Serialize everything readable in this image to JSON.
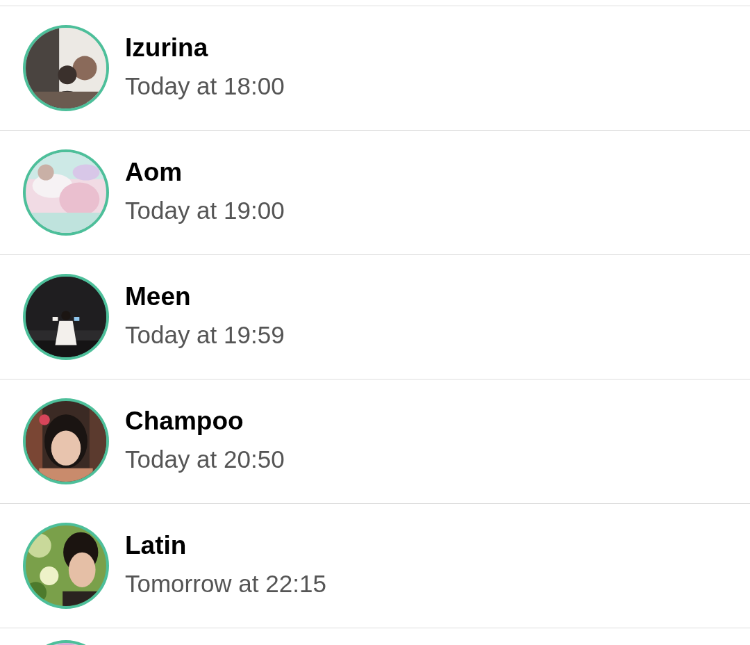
{
  "contacts": [
    {
      "avatar": {
        "kind": "picture"
      },
      "name": "Izurina",
      "time": "Today at 18:00"
    },
    {
      "avatar": {
        "kind": "picture"
      },
      "name": "Aom",
      "time": "Today at 19:00"
    },
    {
      "avatar": {
        "kind": "picture"
      },
      "name": "Meen",
      "time": "Today at 19:59"
    },
    {
      "avatar": {
        "kind": "picture"
      },
      "name": "Champoo",
      "time": "Today at 20:50"
    },
    {
      "avatar": {
        "kind": "picture"
      },
      "name": "Latin",
      "time": "Tomorrow at 22:15"
    },
    {
      "avatar": {
        "kind": "picture"
      }
    }
  ]
}
